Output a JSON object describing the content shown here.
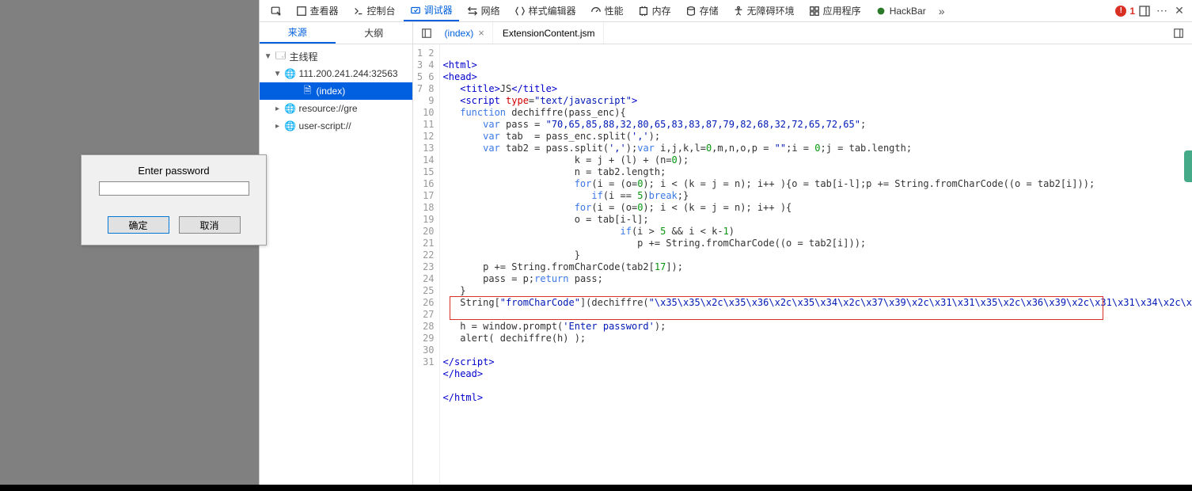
{
  "prompt": {
    "message": "Enter password",
    "input_value": "",
    "ok_label": "确定",
    "cancel_label": "取消"
  },
  "toolbar": {
    "inspector": "查看器",
    "console": "控制台",
    "debugger": "调试器",
    "network": "网络",
    "style": "样式编辑器",
    "performance": "性能",
    "memory": "内存",
    "storage": "存储",
    "accessibility": "无障碍环境",
    "application": "应用程序",
    "hackbar": "HackBar",
    "error_count": "1"
  },
  "sub_tabs": {
    "sources": "来源",
    "outline": "大纲"
  },
  "file_tabs": {
    "index": "(index)",
    "ext": "ExtensionContent.jsm"
  },
  "tree": {
    "main": "主线程",
    "host": "111.200.241.244:32563",
    "index": "(index)",
    "gre": "resource://gre",
    "userscript": "user-script://"
  },
  "code": {
    "l1": "",
    "l2": "<html>",
    "l3": "<head>",
    "l4_a": "<title>",
    "l4_b": "JS",
    "l4_c": "</title>",
    "l5_a": "<script ",
    "l5_b": "type",
    "l5_c": "=",
    "l5_d": "\"text/javascript\"",
    "l5_e": ">",
    "l6_a": "function",
    "l6_b": " dechiffre(pass_enc){",
    "l7_a": "var",
    "l7_b": " pass = ",
    "l7_c": "\"70,65,85,88,32,80,65,83,83,87,79,82,68,32,72,65,72,65\"",
    "l7_d": ";",
    "l8_a": "var",
    "l8_b": " tab  = pass_enc.split(",
    "l8_c": "','",
    "l8_d": ");",
    "l9_a": "var",
    "l9_b": " tab2 = pass.split(",
    "l9_c": "','",
    "l9_d": ");",
    "l9_e": "var",
    "l9_f": " i,j,k,l=",
    "l9_g": "0",
    "l9_h": ",m,n,o,p = ",
    "l9_i": "\"\"",
    "l9_j": ";i = ",
    "l9_k": "0",
    "l9_l": ";j = tab.length;",
    "l10_a": "k = j + (l) + (n=",
    "l10_b": "0",
    "l10_c": ");",
    "l11": "n = tab2.length;",
    "l12_a": "for",
    "l12_b": "(i = (o=",
    "l12_c": "0",
    "l12_d": "); i < (k = j = n); i++ ){o = tab[i-l];p += String.fromCharCode((o = tab2[i]));",
    "l13_a": "if",
    "l13_b": "(i == ",
    "l13_c": "5",
    "l13_d": ")",
    "l13_e": "break",
    "l13_f": ";}",
    "l14_a": "for",
    "l14_b": "(i = (o=",
    "l14_c": "0",
    "l14_d": "); i < (k = j = n); i++ ){",
    "l15": "o = tab[i-l];",
    "l16_a": "if",
    "l16_b": "(i > ",
    "l16_c": "5",
    "l16_d": " && i < k-",
    "l16_e": "1",
    "l16_f": ")",
    "l17": "p += String.fromCharCode((o = tab2[i]));",
    "l18": "}",
    "l19_a": "p += String.fromCharCode(tab2[",
    "l19_b": "17",
    "l19_c": "]);",
    "l20_a": "pass = p;",
    "l20_b": "return",
    "l20_c": " pass;",
    "l21": "}",
    "l22_a": "String[",
    "l22_b": "\"fromCharCode\"",
    "l22_c": "](dechiffre(",
    "l22_d": "\"\\x35\\x35\\x2c\\x35\\x36\\x2c\\x35\\x34\\x2c\\x37\\x39\\x2c\\x31\\x31\\x35\\x2c\\x36\\x39\\x2c\\x31\\x31\\x34\\x2c\\x",
    "l23": "",
    "l24_a": "h = window.prompt(",
    "l24_b": "'Enter password'",
    "l24_c": ");",
    "l25": "alert( dechiffre(h) );",
    "l26": "",
    "l27": "</script>",
    "l28": "</head>",
    "l29": "",
    "l30": "</html>",
    "l31": ""
  }
}
